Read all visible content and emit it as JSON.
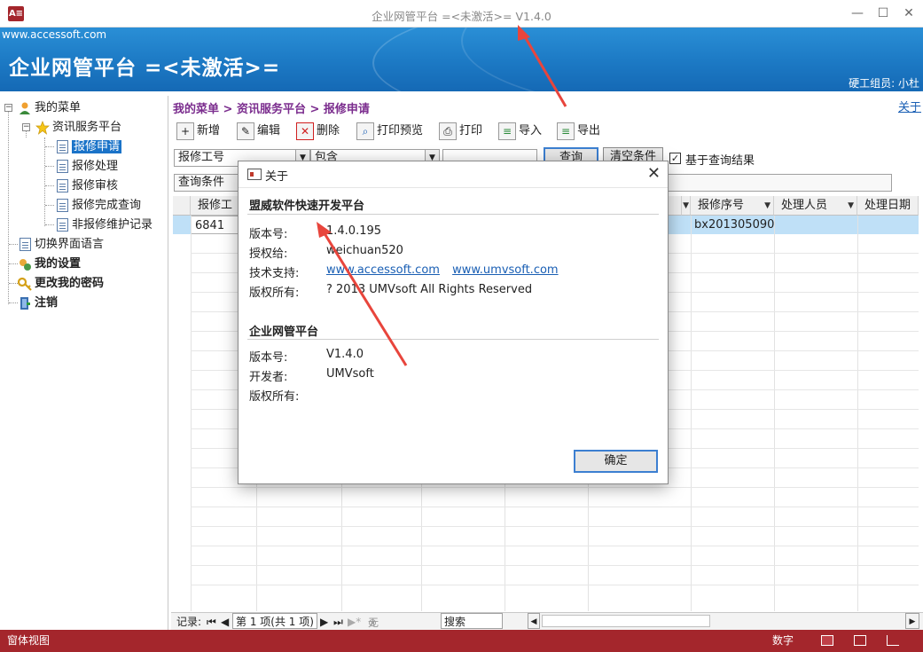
{
  "window": {
    "title": "企业网管平台 =<未激活>= V1.4.0",
    "app_icon": "A≡",
    "minimize": "—",
    "maximize": "☐",
    "close": "✕"
  },
  "banner": {
    "site": "www.accessoft.com",
    "title": "企业网管平台 =<未激活>=",
    "user": "硬工组员: 小杜"
  },
  "sidebar": {
    "items": [
      {
        "label": "我的菜单",
        "icon": "user-icon"
      },
      {
        "label": "资讯服务平台",
        "icon": "star-icon"
      },
      {
        "label": "报修申请",
        "icon": "document-icon"
      },
      {
        "label": "报修处理",
        "icon": "document-icon"
      },
      {
        "label": "报修审核",
        "icon": "document-icon"
      },
      {
        "label": "报修完成查询",
        "icon": "document-icon"
      },
      {
        "label": "非报修维护记录",
        "icon": "document-icon"
      },
      {
        "label": "切换界面语言",
        "icon": "document-icon"
      },
      {
        "label": "我的设置",
        "icon": "settings-icon"
      },
      {
        "label": "更改我的密码",
        "icon": "key-icon"
      },
      {
        "label": "注销",
        "icon": "logout-icon"
      }
    ],
    "expander_minus": "−"
  },
  "main": {
    "breadcrumb": "我的菜单 > 资讯服务平台 > 报修申请",
    "about_link": "关于",
    "toolbar": {
      "new": "新增",
      "edit": "编辑",
      "delete": "删除",
      "print_preview": "打印预览",
      "print": "打印",
      "import": "导入",
      "export": "导出"
    },
    "filter": {
      "field": "报修工号",
      "operator": "包含",
      "value": "",
      "query_button": "查询",
      "clear_button": "清空条件",
      "based_on_result": "基于查询结果",
      "based_on_result_checked": "✓",
      "conditions": "查询条件"
    },
    "grid": {
      "columns": [
        "报修工",
        "报修序号",
        "处理人员",
        "处理日期"
      ],
      "row": {
        "col1": "6841",
        "col2": "bx201305090"
      }
    },
    "navbar": {
      "record_label": "记录:",
      "first": "⏮",
      "prev": "◀",
      "position": "第 1 项(共 1 项)",
      "next": "▶",
      "last": "⏭",
      "new_record": "▶*",
      "no_filter": "无筛选器",
      "search": "搜索",
      "scroll_left": "◀",
      "scroll_right": "▶"
    }
  },
  "status": {
    "left": "窗体视图",
    "numlock": "数字"
  },
  "dialog": {
    "title": "关于",
    "close": "✕",
    "section1": {
      "title": "盟威软件快速开发平台",
      "version_label": "版本号:",
      "version": "1.4.0.195",
      "licensed_label": "授权给:",
      "licensed": "weichuan520",
      "support_label": "技术支持:",
      "support_link1": "www.accessoft.com",
      "support_link2": "www.umvsoft.com",
      "copyright_label": "版权所有:",
      "copyright": "? 2013 UMVsoft All Rights Reserved"
    },
    "section2": {
      "title": "企业网管平台",
      "version_label": "版本号:",
      "version": "V1.4.0",
      "developer_label": "开发者:",
      "developer": "UMVsoft",
      "copyright_label": "版权所有:"
    },
    "ok_button": "确定"
  },
  "colors": {
    "banner": "#1c79c4",
    "status_bar": "#a4262c",
    "selection": "#1a73c8",
    "breadcrumb": "#7b2d8e",
    "arrow": "#e8453c"
  }
}
